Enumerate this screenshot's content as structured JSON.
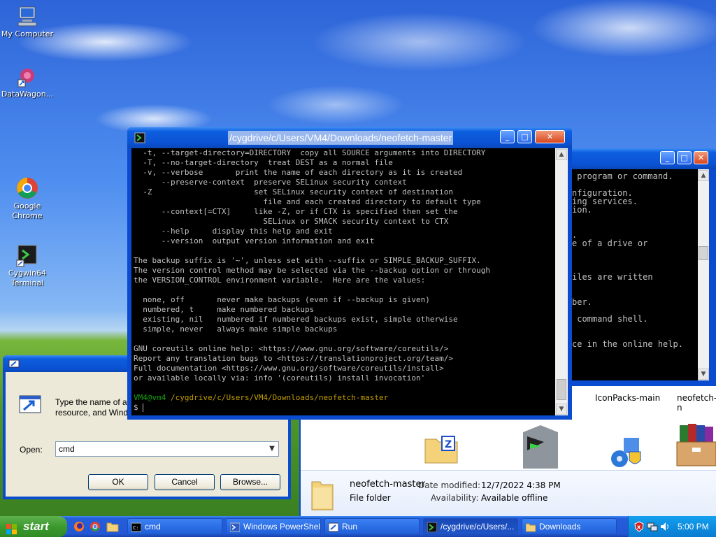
{
  "desktop": {
    "icons": [
      {
        "label": "My Computer"
      },
      {
        "label": "DataWagon..."
      },
      {
        "label": "Google Chrome"
      },
      {
        "label": "Cygwin64 Terminal"
      }
    ]
  },
  "cygwin": {
    "title": "/cygdrive/c/Users/VM4/Downloads/neofetch-master",
    "lines": [
      "  -t, --target-directory=DIRECTORY  copy all SOURCE arguments into DIRECTORY",
      "  -T, --no-target-directory  treat DEST as a normal file",
      "  -v, --verbose       print the name of each directory as it is created",
      "      --preserve-context  preserve SELinux security context",
      "  -Z                      set SELinux security context of destination",
      "                            file and each created directory to default type",
      "      --context[=CTX]     like -Z, or if CTX is specified then set the",
      "                            SELinux or SMACK security context to CTX",
      "      --help     display this help and exit",
      "      --version  output version information and exit",
      "",
      "The backup suffix is '~', unless set with --suffix or SIMPLE_BACKUP_SUFFIX.",
      "The version control method may be selected via the --backup option or through",
      "the VERSION_CONTROL environment variable.  Here are the values:",
      "",
      "  none, off       never make backups (even if --backup is given)",
      "  numbered, t     make numbered backups",
      "  existing, nil   numbered if numbered backups exist, simple otherwise",
      "  simple, never   always make simple backups",
      "",
      "GNU coreutils online help: <https://www.gnu.org/software/coreutils/>",
      "Report any translation bugs to <https://translationproject.org/team/>",
      "Full documentation <https://www.gnu.org/software/coreutils/install>",
      "or available locally via: info '(coreutils) install invocation'",
      ""
    ],
    "prompt_user": "VM4@vm4",
    "prompt_path": "/cygdrive/c/Users/VM4/Downloads/neofetch-master",
    "prompt_symbol": "$",
    "colors": {
      "prompt_user": "#13a10e",
      "prompt_path": "#c19c00"
    }
  },
  "cmd_bg": {
    "lines": [
      " program or command.",
      "",
      "nfiguration.",
      "ing services.",
      "ion.",
      "",
      "",
      ".",
      "e of a drive or",
      "",
      "",
      "",
      "iles are written",
      "",
      "",
      "ber.",
      "",
      " command shell.",
      "",
      "",
      "ce in the online help."
    ]
  },
  "explorer": {
    "items": [
      {
        "label": "IconPacks-main"
      },
      {
        "label": "neofetch-n"
      }
    ],
    "details": {
      "name": "neofetch-master",
      "type": "File folder",
      "date_key": "Date modified:",
      "date_val": "12/7/2022 4:38 PM",
      "avail_key": "Availability:",
      "avail_val": "Available offline"
    }
  },
  "run": {
    "description": "Type the name of a program, folder, document, or Internet resource, and Windows will open it for you.",
    "description_visible_1": "Type the name of a",
    "description_visible_2": "resource, and Windo",
    "open_label": "Open:",
    "open_value": "cmd",
    "ok": "OK",
    "cancel": "Cancel",
    "browse": "Browse..."
  },
  "taskbar": {
    "start": "start",
    "tasks": [
      {
        "label": "cmd"
      },
      {
        "label": "Windows PowerShell"
      },
      {
        "label": "Run"
      },
      {
        "label": "/cygdrive/c/Users/..."
      },
      {
        "label": "Downloads"
      }
    ],
    "clock": "5:00 PM"
  }
}
